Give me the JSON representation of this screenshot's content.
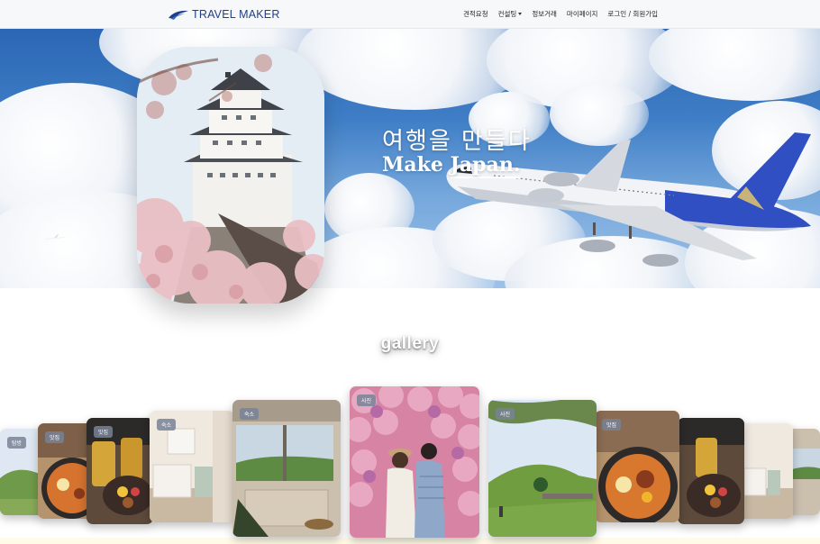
{
  "brand": {
    "name": "TRAVEL MAKER"
  },
  "nav": {
    "items": [
      {
        "label": "견적요청"
      },
      {
        "label": "컨설팅"
      },
      {
        "label": "정보거래"
      },
      {
        "label": "마이페이지"
      },
      {
        "label": "로그인 / 회원가입"
      }
    ]
  },
  "hero": {
    "title_ko": "여행을 만들다",
    "title_en_prefix": "Make ",
    "title_en_underlined": "Japan."
  },
  "gallery": {
    "title": "gallery",
    "cards": [
      {
        "tag": "탐방"
      },
      {
        "tag": "맛집"
      },
      {
        "tag": "맛집"
      },
      {
        "tag": "숙소"
      },
      {
        "tag": "숙소"
      },
      {
        "tag": "사진"
      },
      {
        "tag": "사진"
      },
      {
        "tag": "맛집"
      },
      {
        "tag": ""
      },
      {
        "tag": ""
      },
      {
        "tag": ""
      }
    ]
  },
  "colors": {
    "brand": "#1f3f8a",
    "nav_bg": "#f7f8fa",
    "sky": "#2b66b4"
  }
}
